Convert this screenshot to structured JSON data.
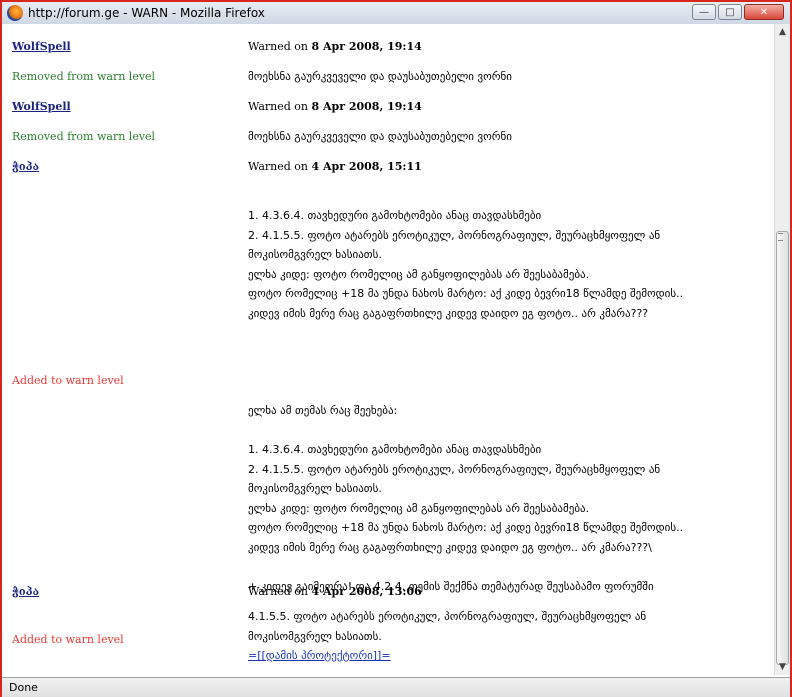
{
  "window": {
    "title": "http://forum.ge - WARN - Mozilla Firefox",
    "minimize": "—",
    "maximize": "□",
    "close": "✕"
  },
  "entries": [
    {
      "user": "WolfSpell",
      "warned_prefix": "Warned on ",
      "date": "8 Apr 2008, 19:14",
      "status": "Removed from warn level",
      "message": "მოეხსნა გაურკვეველი და დაუსაბუთებელი ვორნი"
    },
    {
      "user": "WolfSpell",
      "warned_prefix": "Warned on ",
      "date": "8 Apr 2008, 19:14",
      "status": "Removed from warn level",
      "message": "მოეხსნა გაურკვეველი და დაუსაბუთებელი ვორნი"
    },
    {
      "user": "ჭიპა",
      "warned_prefix": "Warned on ",
      "date": "4 Apr 2008, 15:11",
      "status": "Added to warn level",
      "message": "1. 4.3.6.4. თავხედური გამოხტომები ანაც თავდასხმები\n2. 4.1.5.5. ფოტო ატარებს ეროტიკულ, პორნოგრაფიულ, შეურაცხმყოფელ ან\nმოკისომგვრელ ხასიათს.\nელხა კიდე: ფოტო რომელიც ამ განყოფილებას არ შეესაბამება.\nფოტო რომელიც +18 მა უნდა ნახოს მარტო: აქ კიდე ბევრი18 წლამდე შემოდის..\nკიდევ იმის მერე რაც გაგაფრთხილე კიდევ დაიდო ეგ ფოტო.. არ კმარა???\n\n\n\n\nელხა ამ თემას რაც შეეხება:\n\n1. 4.3.6.4. თავხედური გამოხტომები ანაც თავდასხმები\n2. 4.1.5.5. ფოტო ატარებს ეროტიკულ, პორნოგრაფიულ, შეურაცხმყოფელ ან\nმოკისომგვრელ ხასიათს.\nელხა კიდე: ფოტო რომელიც ამ განყოფილებას არ შეესაბამება.\nფოტო რომელიც +18 მა უნდა ნახოს მარტო: აქ კიდე ბევრი18 წლამდე შემოდის..\nკიდევ იმის მერე რაც გაგაფრთხილე კიდევ დაიდო ეგ ფოტო.. არ კმარა???\\\n\n+ კიდევ გაიმეორა! და 4.2.4. თემის შექმნა თემატურად შეუსაბამო ფორუმში"
    },
    {
      "user": "ჭიპა",
      "warned_prefix": "Warned on ",
      "date": "4 Apr 2008, 13:06",
      "status": "Added to warn level",
      "message": "4.1.5.5. ფოტო ატარებს ეროტიკულ, პორნოგრაფიულ, შეურაცხმყოფელ ან\nმოკისომგვრელ ხასიათს.",
      "link": "=[[დამის პროტექტორი]]="
    }
  ],
  "statusbar": {
    "text": "Done"
  }
}
